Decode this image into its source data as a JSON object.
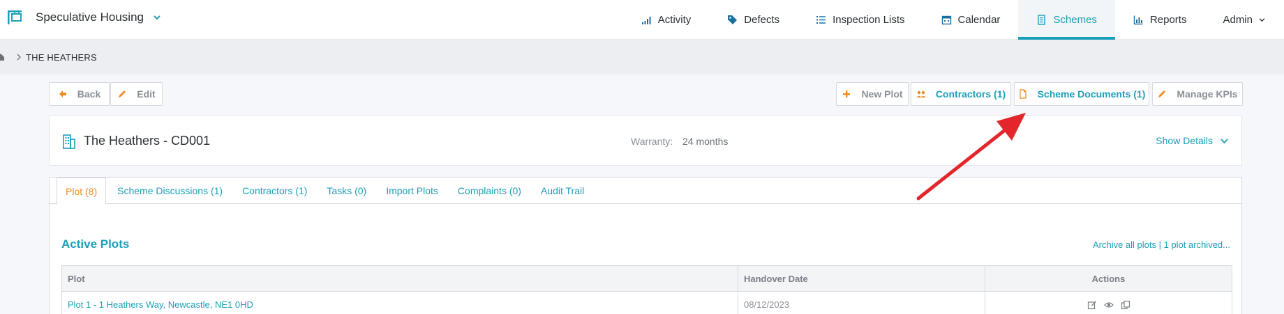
{
  "app": {
    "title": "Speculative Housing"
  },
  "nav": {
    "items": [
      {
        "label": "Activity",
        "icon": "activity-icon"
      },
      {
        "label": "Defects",
        "icon": "tag-icon"
      },
      {
        "label": "Inspection Lists",
        "icon": "list-icon"
      },
      {
        "label": "Calendar",
        "icon": "calendar-icon"
      },
      {
        "label": "Schemes",
        "icon": "document-icon",
        "active": true
      },
      {
        "label": "Reports",
        "icon": "bar-chart-icon"
      },
      {
        "label": "Admin",
        "icon": "chevron-down-icon"
      }
    ]
  },
  "breadcrumb": {
    "current": "THE HEATHERS"
  },
  "toolbar": {
    "back_label": "Back",
    "edit_label": "Edit",
    "new_plot_label": "New Plot",
    "contractors_label": "Contractors (1)",
    "scheme_docs_label": "Scheme Documents (1)",
    "manage_kpis_label": "Manage KPIs"
  },
  "scheme": {
    "title": "The Heathers - CD001",
    "warranty_label": "Warranty:",
    "warranty_value": "24 months",
    "show_details_label": "Show Details"
  },
  "tabs": [
    {
      "label": "Plot (8)",
      "active": true
    },
    {
      "label": "Scheme Discussions (1)"
    },
    {
      "label": "Contractors (1)"
    },
    {
      "label": "Tasks (0)"
    },
    {
      "label": "Import Plots"
    },
    {
      "label": "Complaints (0)"
    },
    {
      "label": "Audit Trail"
    }
  ],
  "plots": {
    "section_title": "Active Plots",
    "archive_link": "Archive all plots | 1 plot archived...",
    "columns": [
      "Plot",
      "Handover Date",
      "Actions"
    ],
    "rows": [
      {
        "plot": "Plot 1 -   1 Heathers Way, Newcastle, NE1 0HD",
        "handover_date": "08/12/2023"
      }
    ]
  },
  "colors": {
    "accent": "#1b9fb8",
    "active_tab": "#ef8a1e",
    "annotation": "#e3262b"
  }
}
